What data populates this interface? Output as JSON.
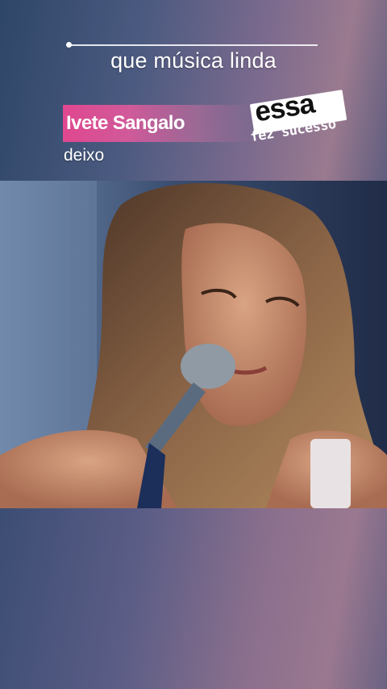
{
  "overlay": {
    "caption": "que música linda",
    "artist": "Ivete Sangalo",
    "song": "deixo"
  },
  "logo": {
    "line1": "essa",
    "line2": "fez sucesso"
  },
  "colors": {
    "artist_tag": "#e0478f",
    "background": "#48547a"
  }
}
